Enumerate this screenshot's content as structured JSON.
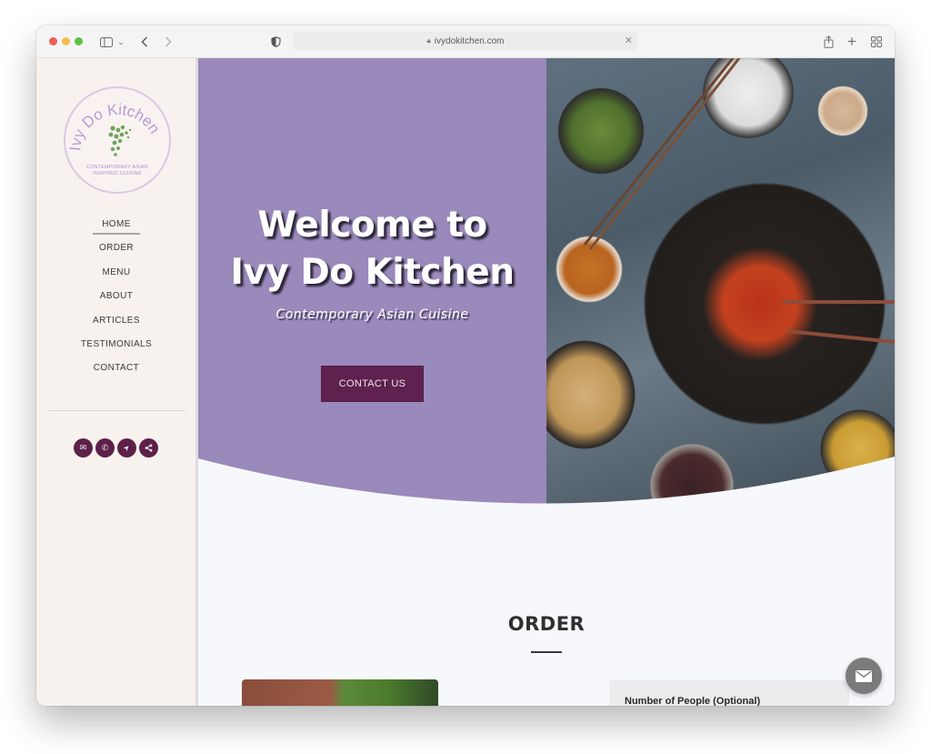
{
  "browser": {
    "url": "ivydokitchen.com",
    "toolbar_icons": [
      "sidebar-icon",
      "chevron-down-icon",
      "back-icon",
      "forward-icon",
      "shield-icon",
      "share-icon",
      "new-tab-icon",
      "tab-overview-icon"
    ]
  },
  "sidebar": {
    "logo": {
      "name": "Ivy Do Kitchen",
      "tagline_line1": "CONTEMPORARY ASIAN",
      "tagline_line2": "INSPIRED CUISINE"
    },
    "nav": [
      {
        "label": "HOME",
        "active": true
      },
      {
        "label": "ORDER",
        "active": false
      },
      {
        "label": "MENU",
        "active": false
      },
      {
        "label": "ABOUT",
        "active": false
      },
      {
        "label": "ARTICLES",
        "active": false
      },
      {
        "label": "TESTIMONIALS",
        "active": false
      },
      {
        "label": "CONTACT",
        "active": false
      }
    ],
    "social": [
      {
        "icon": "envelope-icon",
        "glyph": "✉"
      },
      {
        "icon": "phone-icon",
        "glyph": "✆"
      },
      {
        "icon": "location-arrow-icon",
        "glyph": "➤"
      },
      {
        "icon": "share-icon",
        "glyph": "⋖"
      }
    ]
  },
  "hero": {
    "title_line1": "Welcome to",
    "title_line2": "Ivy Do Kitchen",
    "subtitle": "Contemporary Asian Cuisine",
    "button": "CONTACT US",
    "colors": {
      "panel": "#9a89bb",
      "button": "#5f2150"
    }
  },
  "order": {
    "title": "ORDER",
    "form_label": "Number of People (Optional)"
  },
  "floating": {
    "icon": "envelope-icon",
    "glyph": "✉"
  }
}
